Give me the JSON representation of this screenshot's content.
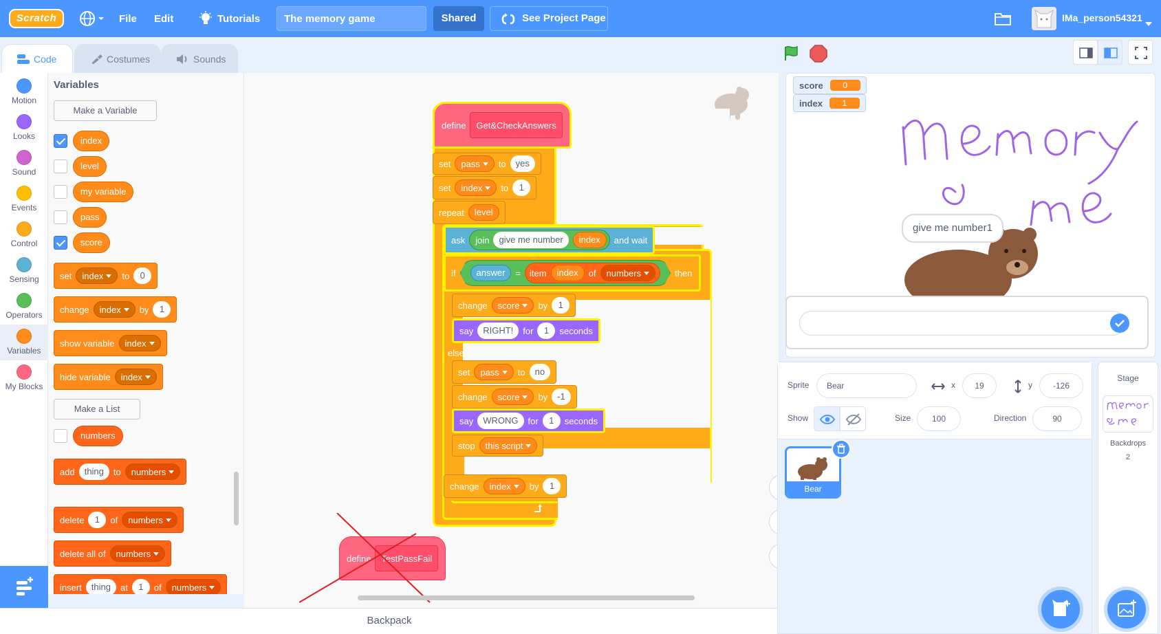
{
  "menubar": {
    "logo": "Scratch",
    "file": "File",
    "edit": "Edit",
    "tutorials": "Tutorials",
    "project_title": "The memory game",
    "shared": "Shared",
    "see_project_page": "See Project Page",
    "username": "IMa_person54321"
  },
  "tabs": {
    "code": "Code",
    "costumes": "Costumes",
    "sounds": "Sounds"
  },
  "categories": [
    {
      "label": "Motion",
      "color": "#4c97ff"
    },
    {
      "label": "Looks",
      "color": "#9966ff"
    },
    {
      "label": "Sound",
      "color": "#cf63cf"
    },
    {
      "label": "Events",
      "color": "#ffbf00"
    },
    {
      "label": "Control",
      "color": "#ffab19"
    },
    {
      "label": "Sensing",
      "color": "#5cb1d6"
    },
    {
      "label": "Operators",
      "color": "#59c059"
    },
    {
      "label": "Variables",
      "color": "#ff8c1a"
    },
    {
      "label": "My Blocks",
      "color": "#ff6680"
    }
  ],
  "palette": {
    "header": "Variables",
    "make_variable": "Make a Variable",
    "variables": [
      {
        "name": "index",
        "checked": true
      },
      {
        "name": "level",
        "checked": false
      },
      {
        "name": "my variable",
        "checked": false
      },
      {
        "name": "pass",
        "checked": false
      },
      {
        "name": "score",
        "checked": true
      }
    ],
    "make_list": "Make a List",
    "list": {
      "name": "numbers",
      "checked": false
    },
    "blocks": {
      "set": {
        "label": "set",
        "var": "index",
        "to": "to",
        "value": "0"
      },
      "change": {
        "label": "change",
        "var": "index",
        "by": "by",
        "value": "1"
      },
      "show": {
        "label": "show variable",
        "var": "index"
      },
      "hide": {
        "label": "hide variable",
        "var": "index"
      },
      "add": {
        "label": "add",
        "item": "thing",
        "to": "to",
        "list": "numbers"
      },
      "delete": {
        "label": "delete",
        "value": "1",
        "of": "of",
        "list": "numbers"
      },
      "delete_all": {
        "label": "delete all of",
        "list": "numbers"
      },
      "insert": {
        "label": "insert",
        "item": "thing",
        "at": "at",
        "value": "1",
        "of": "of",
        "list": "numbers"
      }
    }
  },
  "script": {
    "define": "define",
    "proc_name": "Get&CheckAnswers",
    "set1": {
      "label": "set",
      "var": "pass",
      "to": "to",
      "value": "yes"
    },
    "set2": {
      "label": "set",
      "var": "index",
      "to": "to",
      "value": "1"
    },
    "repeat": {
      "label": "repeat",
      "var": "level"
    },
    "ask": {
      "label": "ask",
      "join": "join",
      "text": "give me number",
      "var": "index",
      "and_wait": "and wait"
    },
    "if": {
      "label": "if",
      "answer": "answer",
      "eq": "=",
      "item": "item",
      "var": "index",
      "of": "of",
      "list": "numbers",
      "then": "then"
    },
    "change_score1": {
      "label": "change",
      "var": "score",
      "by": "by",
      "value": "1"
    },
    "say1": {
      "label": "say",
      "text": "RIGHT!",
      "for": "for",
      "value": "1",
      "seconds": "seconds"
    },
    "else": "else",
    "set3": {
      "label": "set",
      "var": "pass",
      "to": "to",
      "value": "no"
    },
    "change_score2": {
      "label": "change",
      "var": "score",
      "by": "by",
      "value": "-1"
    },
    "say2": {
      "label": "say",
      "text": "WRONG",
      "for": "for",
      "value": "1",
      "seconds": "seconds"
    },
    "stop": {
      "label": "stop",
      "option": "this script"
    },
    "change_index": {
      "label": "change",
      "var": "index",
      "by": "by",
      "value": "1"
    },
    "define2": "define",
    "proc2_name": "TestPassFail"
  },
  "backpack": "Backpack",
  "stage": {
    "monitors": [
      {
        "name": "score",
        "value": "0"
      },
      {
        "name": "index",
        "value": "1"
      }
    ],
    "speech": "give me number1"
  },
  "sprite_info": {
    "sprite_label": "Sprite",
    "sprite_name": "Bear",
    "x_label": "x",
    "x": "19",
    "y_label": "y",
    "y": "-126",
    "show_label": "Show",
    "size_label": "Size",
    "size": "100",
    "direction_label": "Direction",
    "direction": "90"
  },
  "sprites": [
    {
      "name": "Bear"
    }
  ],
  "stage_pane": {
    "title": "Stage",
    "backdrops_label": "Backdrops",
    "backdrops_count": "2"
  }
}
